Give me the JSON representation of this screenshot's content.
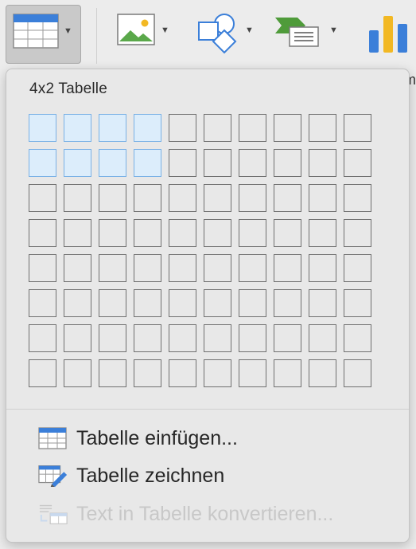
{
  "popup": {
    "title": "4x2 Tabelle",
    "selection": {
      "columns": 4,
      "rows": 2
    },
    "grid": {
      "columns": 10,
      "rows": 8
    }
  },
  "ribbon": {
    "cut_label": "m"
  },
  "menu": {
    "insert_table": {
      "label": "Tabelle einfügen...",
      "icon": "table-icon"
    },
    "draw_table": {
      "label": "Tabelle zeichnen",
      "icon": "table-pencil-icon"
    },
    "convert_text": {
      "label": "Text in Tabelle konvertieren...",
      "icon": "text-to-table-icon",
      "disabled": true
    }
  },
  "colors": {
    "selected_fill": "#dcedfb",
    "selected_border": "#7ab1e6",
    "grid_border": "#707070"
  }
}
